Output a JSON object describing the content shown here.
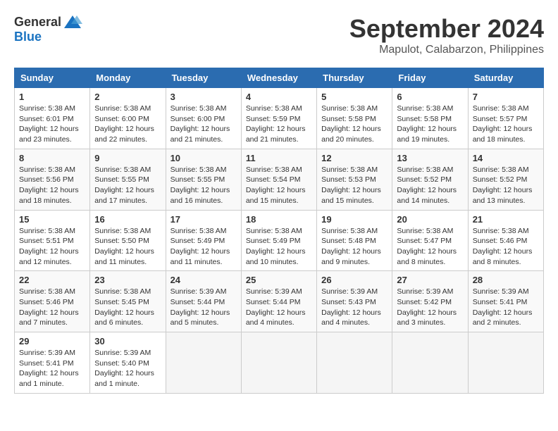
{
  "header": {
    "logo_general": "General",
    "logo_blue": "Blue",
    "month_title": "September 2024",
    "location": "Mapulot, Calabarzon, Philippines"
  },
  "weekdays": [
    "Sunday",
    "Monday",
    "Tuesday",
    "Wednesday",
    "Thursday",
    "Friday",
    "Saturday"
  ],
  "weeks": [
    [
      {
        "day": "1",
        "info": "Sunrise: 5:38 AM\nSunset: 6:01 PM\nDaylight: 12 hours\nand 23 minutes."
      },
      {
        "day": "2",
        "info": "Sunrise: 5:38 AM\nSunset: 6:00 PM\nDaylight: 12 hours\nand 22 minutes."
      },
      {
        "day": "3",
        "info": "Sunrise: 5:38 AM\nSunset: 6:00 PM\nDaylight: 12 hours\nand 21 minutes."
      },
      {
        "day": "4",
        "info": "Sunrise: 5:38 AM\nSunset: 5:59 PM\nDaylight: 12 hours\nand 21 minutes."
      },
      {
        "day": "5",
        "info": "Sunrise: 5:38 AM\nSunset: 5:58 PM\nDaylight: 12 hours\nand 20 minutes."
      },
      {
        "day": "6",
        "info": "Sunrise: 5:38 AM\nSunset: 5:58 PM\nDaylight: 12 hours\nand 19 minutes."
      },
      {
        "day": "7",
        "info": "Sunrise: 5:38 AM\nSunset: 5:57 PM\nDaylight: 12 hours\nand 18 minutes."
      }
    ],
    [
      {
        "day": "8",
        "info": "Sunrise: 5:38 AM\nSunset: 5:56 PM\nDaylight: 12 hours\nand 18 minutes."
      },
      {
        "day": "9",
        "info": "Sunrise: 5:38 AM\nSunset: 5:55 PM\nDaylight: 12 hours\nand 17 minutes."
      },
      {
        "day": "10",
        "info": "Sunrise: 5:38 AM\nSunset: 5:55 PM\nDaylight: 12 hours\nand 16 minutes."
      },
      {
        "day": "11",
        "info": "Sunrise: 5:38 AM\nSunset: 5:54 PM\nDaylight: 12 hours\nand 15 minutes."
      },
      {
        "day": "12",
        "info": "Sunrise: 5:38 AM\nSunset: 5:53 PM\nDaylight: 12 hours\nand 15 minutes."
      },
      {
        "day": "13",
        "info": "Sunrise: 5:38 AM\nSunset: 5:52 PM\nDaylight: 12 hours\nand 14 minutes."
      },
      {
        "day": "14",
        "info": "Sunrise: 5:38 AM\nSunset: 5:52 PM\nDaylight: 12 hours\nand 13 minutes."
      }
    ],
    [
      {
        "day": "15",
        "info": "Sunrise: 5:38 AM\nSunset: 5:51 PM\nDaylight: 12 hours\nand 12 minutes."
      },
      {
        "day": "16",
        "info": "Sunrise: 5:38 AM\nSunset: 5:50 PM\nDaylight: 12 hours\nand 11 minutes."
      },
      {
        "day": "17",
        "info": "Sunrise: 5:38 AM\nSunset: 5:49 PM\nDaylight: 12 hours\nand 11 minutes."
      },
      {
        "day": "18",
        "info": "Sunrise: 5:38 AM\nSunset: 5:49 PM\nDaylight: 12 hours\nand 10 minutes."
      },
      {
        "day": "19",
        "info": "Sunrise: 5:38 AM\nSunset: 5:48 PM\nDaylight: 12 hours\nand 9 minutes."
      },
      {
        "day": "20",
        "info": "Sunrise: 5:38 AM\nSunset: 5:47 PM\nDaylight: 12 hours\nand 8 minutes."
      },
      {
        "day": "21",
        "info": "Sunrise: 5:38 AM\nSunset: 5:46 PM\nDaylight: 12 hours\nand 8 minutes."
      }
    ],
    [
      {
        "day": "22",
        "info": "Sunrise: 5:38 AM\nSunset: 5:46 PM\nDaylight: 12 hours\nand 7 minutes."
      },
      {
        "day": "23",
        "info": "Sunrise: 5:38 AM\nSunset: 5:45 PM\nDaylight: 12 hours\nand 6 minutes."
      },
      {
        "day": "24",
        "info": "Sunrise: 5:39 AM\nSunset: 5:44 PM\nDaylight: 12 hours\nand 5 minutes."
      },
      {
        "day": "25",
        "info": "Sunrise: 5:39 AM\nSunset: 5:44 PM\nDaylight: 12 hours\nand 4 minutes."
      },
      {
        "day": "26",
        "info": "Sunrise: 5:39 AM\nSunset: 5:43 PM\nDaylight: 12 hours\nand 4 minutes."
      },
      {
        "day": "27",
        "info": "Sunrise: 5:39 AM\nSunset: 5:42 PM\nDaylight: 12 hours\nand 3 minutes."
      },
      {
        "day": "28",
        "info": "Sunrise: 5:39 AM\nSunset: 5:41 PM\nDaylight: 12 hours\nand 2 minutes."
      }
    ],
    [
      {
        "day": "29",
        "info": "Sunrise: 5:39 AM\nSunset: 5:41 PM\nDaylight: 12 hours\nand 1 minute."
      },
      {
        "day": "30",
        "info": "Sunrise: 5:39 AM\nSunset: 5:40 PM\nDaylight: 12 hours\nand 1 minute."
      },
      {
        "day": "",
        "info": ""
      },
      {
        "day": "",
        "info": ""
      },
      {
        "day": "",
        "info": ""
      },
      {
        "day": "",
        "info": ""
      },
      {
        "day": "",
        "info": ""
      }
    ]
  ]
}
